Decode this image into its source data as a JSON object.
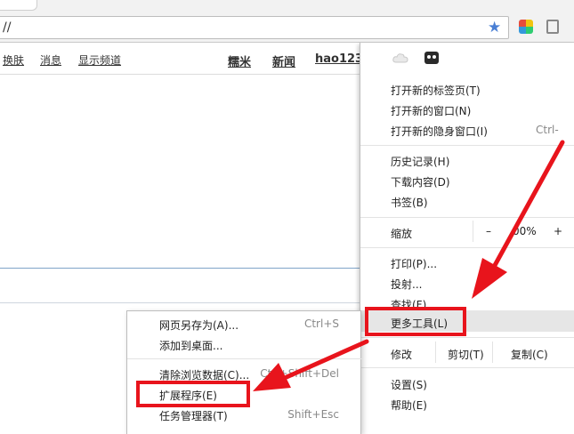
{
  "address_bar": {
    "url": "//"
  },
  "icons": {
    "bookmark_star": "star-icon",
    "extension": "extension-icon",
    "menu": "chrome-menu-icon"
  },
  "nav": {
    "links": [
      "换肤",
      "消息",
      "显示频道"
    ],
    "right_links": [
      "糯米",
      "新闻",
      "hao123"
    ]
  },
  "main_menu": {
    "new_tab": "打开新的标签页(T)",
    "new_window": "打开新的窗口(N)",
    "new_incognito": "打开新的隐身窗口(I)",
    "new_incognito_shortcut": "Ctrl-",
    "history": "历史记录(H)",
    "downloads": "下载内容(D)",
    "bookmarks": "书签(B)",
    "zoom_label": "缩放",
    "zoom_minus": "–",
    "zoom_value": "00%",
    "zoom_plus": "+",
    "print": "打印(P)...",
    "cast": "投射...",
    "find": "查找(F)...",
    "more_tools": "更多工具(L)",
    "edit_label": "修改",
    "cut": "剪切(T)",
    "copy": "复制(C)",
    "settings": "设置(S)",
    "help": "帮助(E)"
  },
  "sub_menu": {
    "save_page": "网页另存为(A)...",
    "save_page_shortcut": "Ctrl+S",
    "add_to_desktop": "添加到桌面...",
    "clear_data": "清除浏览数据(C)...",
    "clear_data_shortcut": "Ctrl+Shift+Del",
    "extensions": "扩展程序(E)",
    "task_manager": "任务管理器(T)",
    "task_manager_shortcut": "Shift+Esc"
  },
  "colors": {
    "annotation_red": "#e8141c",
    "star_blue": "#4a7fd4"
  }
}
